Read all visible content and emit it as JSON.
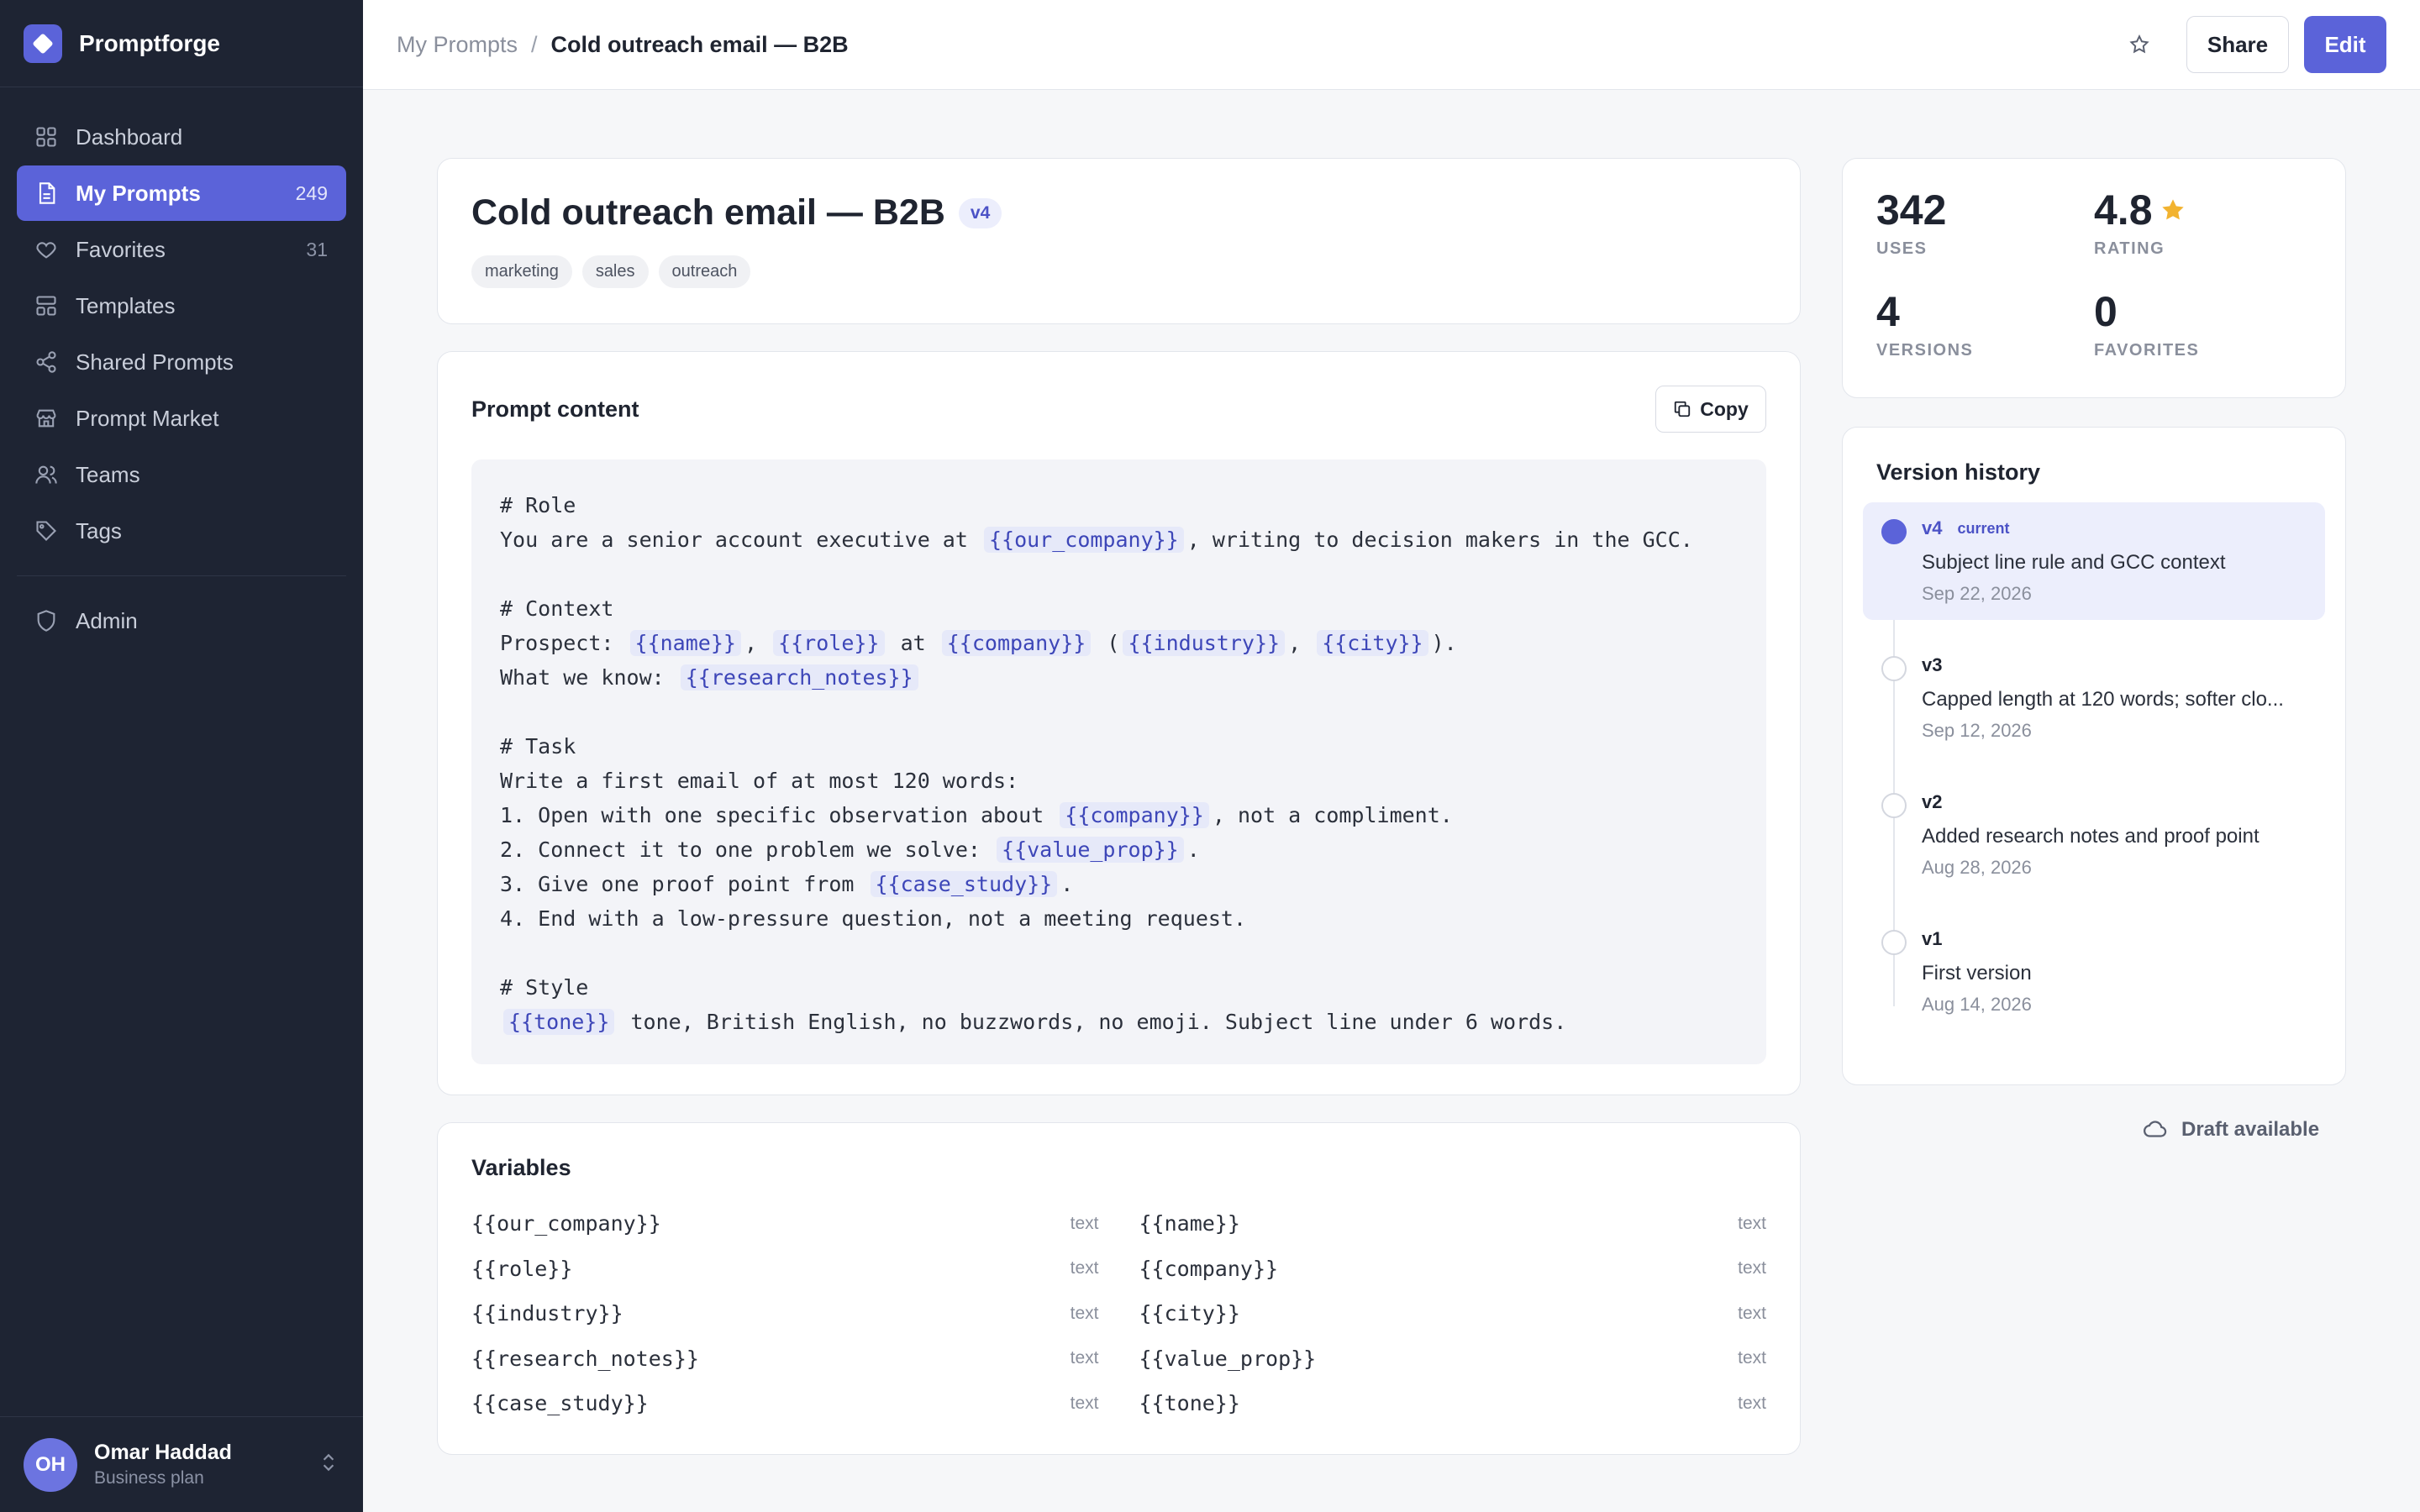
{
  "brand": {
    "name": "Promptforge"
  },
  "nav": {
    "items": [
      {
        "label": "Dashboard",
        "count": ""
      },
      {
        "label": "My Prompts",
        "count": "249"
      },
      {
        "label": "Favorites",
        "count": "31"
      },
      {
        "label": "Templates",
        "count": ""
      },
      {
        "label": "Shared Prompts",
        "count": ""
      },
      {
        "label": "Prompt Market",
        "count": ""
      },
      {
        "label": "Teams",
        "count": ""
      },
      {
        "label": "Tags",
        "count": ""
      }
    ],
    "admin": "Admin"
  },
  "user": {
    "initials": "OH",
    "name": "Omar Haddad",
    "plan": "Business plan"
  },
  "breadcrumb": {
    "parent": "My Prompts",
    "sep": "/",
    "current": "Cold outreach email — B2B"
  },
  "toolbar": {
    "share_label": "Share",
    "edit_label": "Edit"
  },
  "prompt": {
    "title": "Cold outreach email — B2B",
    "version": "v4",
    "tags": [
      "marketing",
      "sales",
      "outreach"
    ]
  },
  "content": {
    "title": "Prompt content",
    "copy_label": "Copy",
    "lines": {
      "l1": "# Role",
      "l2a": "You are a senior account executive at",
      "l2v1": "{{our_company}}",
      "l2b": ", writing to decision makers in the GCC.",
      "l4": "# Context",
      "l5a": "Prospect:",
      "l5v1": "{{name}}",
      "l5b": ",",
      "l5v2": "{{role}}",
      "l5c": "at",
      "l5v3": "{{company}}",
      "l5d": "(",
      "l5v4": "{{industry}}",
      "l5e": ",",
      "l5v5": "{{city}}",
      "l5f": ").",
      "l6a": "What we know:",
      "l6v1": "{{research_notes}}",
      "l8": "# Task",
      "l9": "Write a first email of at most 120 words:",
      "l10a": "1. Open with one specific observation about",
      "l10v1": "{{company}}",
      "l10b": ", not a compliment.",
      "l11a": "2. Connect it to one problem we solve:",
      "l11v1": "{{value_prop}}",
      "l11b": ".",
      "l12a": "3. Give one proof point from",
      "l12v1": "{{case_study}}",
      "l12b": ".",
      "l13": "4. End with a low-pressure question, not a meeting request.",
      "l15": "# Style",
      "l16v1": "{{tone}}",
      "l16a": "tone, British English, no buzzwords, no emoji. Subject line under 6 words."
    }
  },
  "variables": {
    "title": "Variables",
    "items": [
      {
        "name": "{{our_company}}",
        "type": "text"
      },
      {
        "name": "{{name}}",
        "type": "text"
      },
      {
        "name": "{{role}}",
        "type": "text"
      },
      {
        "name": "{{company}}",
        "type": "text"
      },
      {
        "name": "{{industry}}",
        "type": "text"
      },
      {
        "name": "{{city}}",
        "type": "text"
      },
      {
        "name": "{{research_notes}}",
        "type": "text"
      },
      {
        "name": "{{value_prop}}",
        "type": "text"
      },
      {
        "name": "{{case_study}}",
        "type": "text"
      },
      {
        "name": "{{tone}}",
        "type": "text"
      }
    ]
  },
  "stats": {
    "uses": {
      "value": "342",
      "label": "USES"
    },
    "rating": {
      "value": "4.8",
      "label": "RATING"
    },
    "versions": {
      "value": "4",
      "label": "VERSIONS"
    },
    "favorites": {
      "value": "0",
      "label": "FAVORITES"
    }
  },
  "history": {
    "title": "Version history",
    "current_label": "current",
    "items": [
      {
        "version": "v4",
        "desc": "Subject line rule and GCC context",
        "date": "Sep 22, 2026"
      },
      {
        "version": "v3",
        "desc": "Capped length at 120 words; softer clo...",
        "date": "Sep 12, 2026"
      },
      {
        "version": "v2",
        "desc": "Added research notes and proof point",
        "date": "Aug 28, 2026"
      },
      {
        "version": "v1",
        "desc": "First version",
        "date": "Aug 14, 2026"
      }
    ]
  },
  "draft": {
    "label": "Draft available"
  },
  "colors": {
    "accent": "#5b63d9",
    "sidebar": "#1e2433",
    "star": "#f2b330"
  }
}
